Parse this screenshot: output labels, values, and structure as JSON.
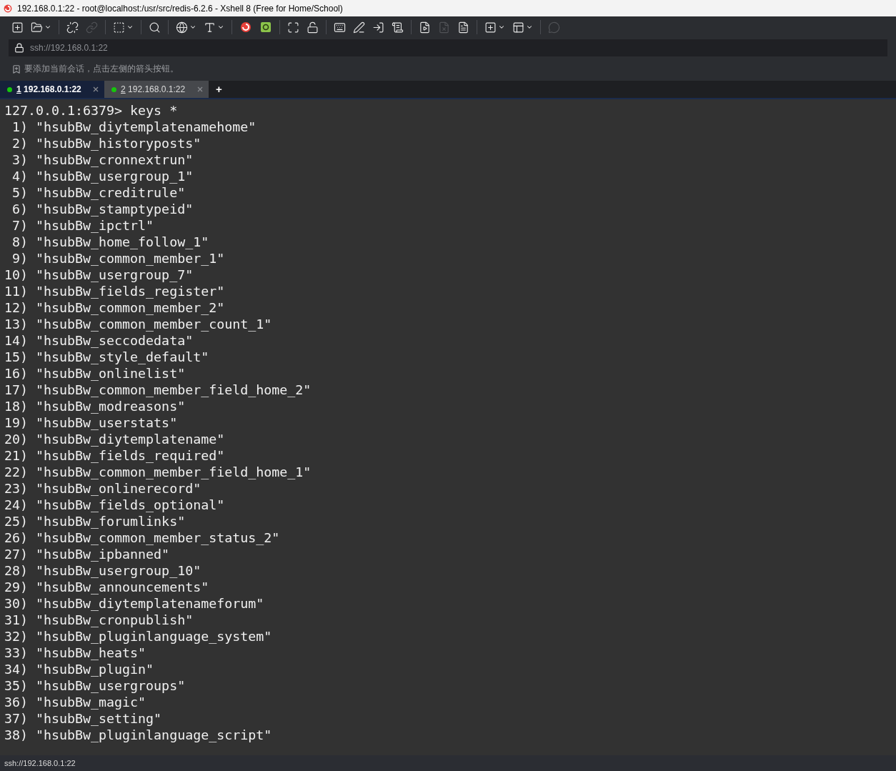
{
  "window": {
    "title": "192.168.0.1:22 - root@localhost:/usr/src/redis-6.2.6 - Xshell 8 (Free for Home/School)"
  },
  "toolbar": [
    {
      "kind": "new",
      "disabled": false
    },
    {
      "kind": "open",
      "disabled": false
    },
    {
      "kind": "sep"
    },
    {
      "kind": "disconnect",
      "disabled": false
    },
    {
      "kind": "link",
      "disabled": true
    },
    {
      "kind": "sep"
    },
    {
      "kind": "properties",
      "disabled": false
    },
    {
      "kind": "sep"
    },
    {
      "kind": "search",
      "disabled": false
    },
    {
      "kind": "sep"
    },
    {
      "kind": "globe",
      "disabled": false
    },
    {
      "kind": "font",
      "disabled": false
    },
    {
      "kind": "sep"
    },
    {
      "kind": "swirl",
      "disabled": false
    },
    {
      "kind": "xftp",
      "disabled": false
    },
    {
      "kind": "sep"
    },
    {
      "kind": "fullscreen",
      "disabled": false
    },
    {
      "kind": "lock",
      "disabled": false
    },
    {
      "kind": "sep"
    },
    {
      "kind": "keyboard",
      "disabled": false
    },
    {
      "kind": "pen",
      "disabled": false
    },
    {
      "kind": "login",
      "disabled": false
    },
    {
      "kind": "script",
      "disabled": false
    },
    {
      "kind": "sep"
    },
    {
      "kind": "play",
      "disabled": false
    },
    {
      "kind": "stop",
      "disabled": true
    },
    {
      "kind": "log",
      "disabled": false
    },
    {
      "kind": "sep"
    },
    {
      "kind": "newtab",
      "disabled": false
    },
    {
      "kind": "layout",
      "disabled": false
    },
    {
      "kind": "sep"
    },
    {
      "kind": "chat",
      "disabled": true
    }
  ],
  "address": {
    "value": "ssh://192.168.0.1:22"
  },
  "hint": "要添加当前会话，点击左侧的箭头按钮。",
  "tabs": [
    {
      "number": "1",
      "label": "192.168.0.1:22",
      "selected": true,
      "color": "#16c60c"
    },
    {
      "number": "2",
      "label": "192.168.0.1:22",
      "selected": false,
      "color": "#16c60c"
    }
  ],
  "new_tab": "+",
  "terminal": {
    "lines": [
      "127.0.0.1:6379> keys *",
      " 1) \"hsubBw_diytemplatenamehome\"",
      " 2) \"hsubBw_historyposts\"",
      " 3) \"hsubBw_cronnextrun\"",
      " 4) \"hsubBw_usergroup_1\"",
      " 5) \"hsubBw_creditrule\"",
      " 6) \"hsubBw_stamptypeid\"",
      " 7) \"hsubBw_ipctrl\"",
      " 8) \"hsubBw_home_follow_1\"",
      " 9) \"hsubBw_common_member_1\"",
      "10) \"hsubBw_usergroup_7\"",
      "11) \"hsubBw_fields_register\"",
      "12) \"hsubBw_common_member_2\"",
      "13) \"hsubBw_common_member_count_1\"",
      "14) \"hsubBw_seccodedata\"",
      "15) \"hsubBw_style_default\"",
      "16) \"hsubBw_onlinelist\"",
      "17) \"hsubBw_common_member_field_home_2\"",
      "18) \"hsubBw_modreasons\"",
      "19) \"hsubBw_userstats\"",
      "20) \"hsubBw_diytemplatename\"",
      "21) \"hsubBw_fields_required\"",
      "22) \"hsubBw_common_member_field_home_1\"",
      "23) \"hsubBw_onlinerecord\"",
      "24) \"hsubBw_fields_optional\"",
      "25) \"hsubBw_forumlinks\"",
      "26) \"hsubBw_common_member_status_2\"",
      "27) \"hsubBw_ipbanned\"",
      "28) \"hsubBw_usergroup_10\"",
      "29) \"hsubBw_announcements\"",
      "30) \"hsubBw_diytemplatenameforum\"",
      "31) \"hsubBw_cronpublish\"",
      "32) \"hsubBw_pluginlanguage_system\"",
      "33) \"hsubBw_heats\"",
      "34) \"hsubBw_plugin\"",
      "35) \"hsubBw_usergroups\"",
      "36) \"hsubBw_magic\"",
      "37) \"hsubBw_setting\"",
      "38) \"hsubBw_pluginlanguage_script\""
    ]
  },
  "status_bar": {
    "text": "ssh://192.168.0.1:22"
  }
}
